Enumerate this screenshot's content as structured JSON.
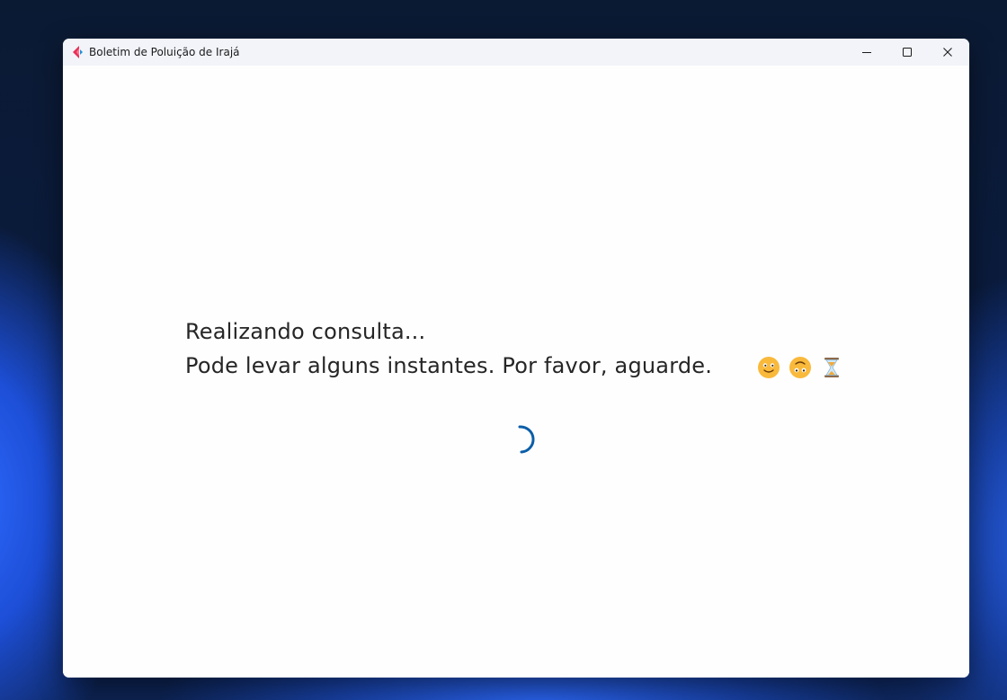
{
  "window": {
    "title": "Boletim de Poluição de Irajá"
  },
  "controls": {
    "minimize_icon": "minimize-icon",
    "maximize_icon": "maximize-icon",
    "close_icon": "close-icon"
  },
  "loading": {
    "line1": "Realizando consulta...",
    "line2": "Pode levar alguns instantes. Por favor, aguarde.",
    "emojis": [
      "smiling-face-icon",
      "upside-down-face-icon",
      "hourglass-icon"
    ]
  },
  "colors": {
    "accent": "#0b5ea8",
    "titlebar": "#f2f4f9",
    "text": "#262626"
  }
}
